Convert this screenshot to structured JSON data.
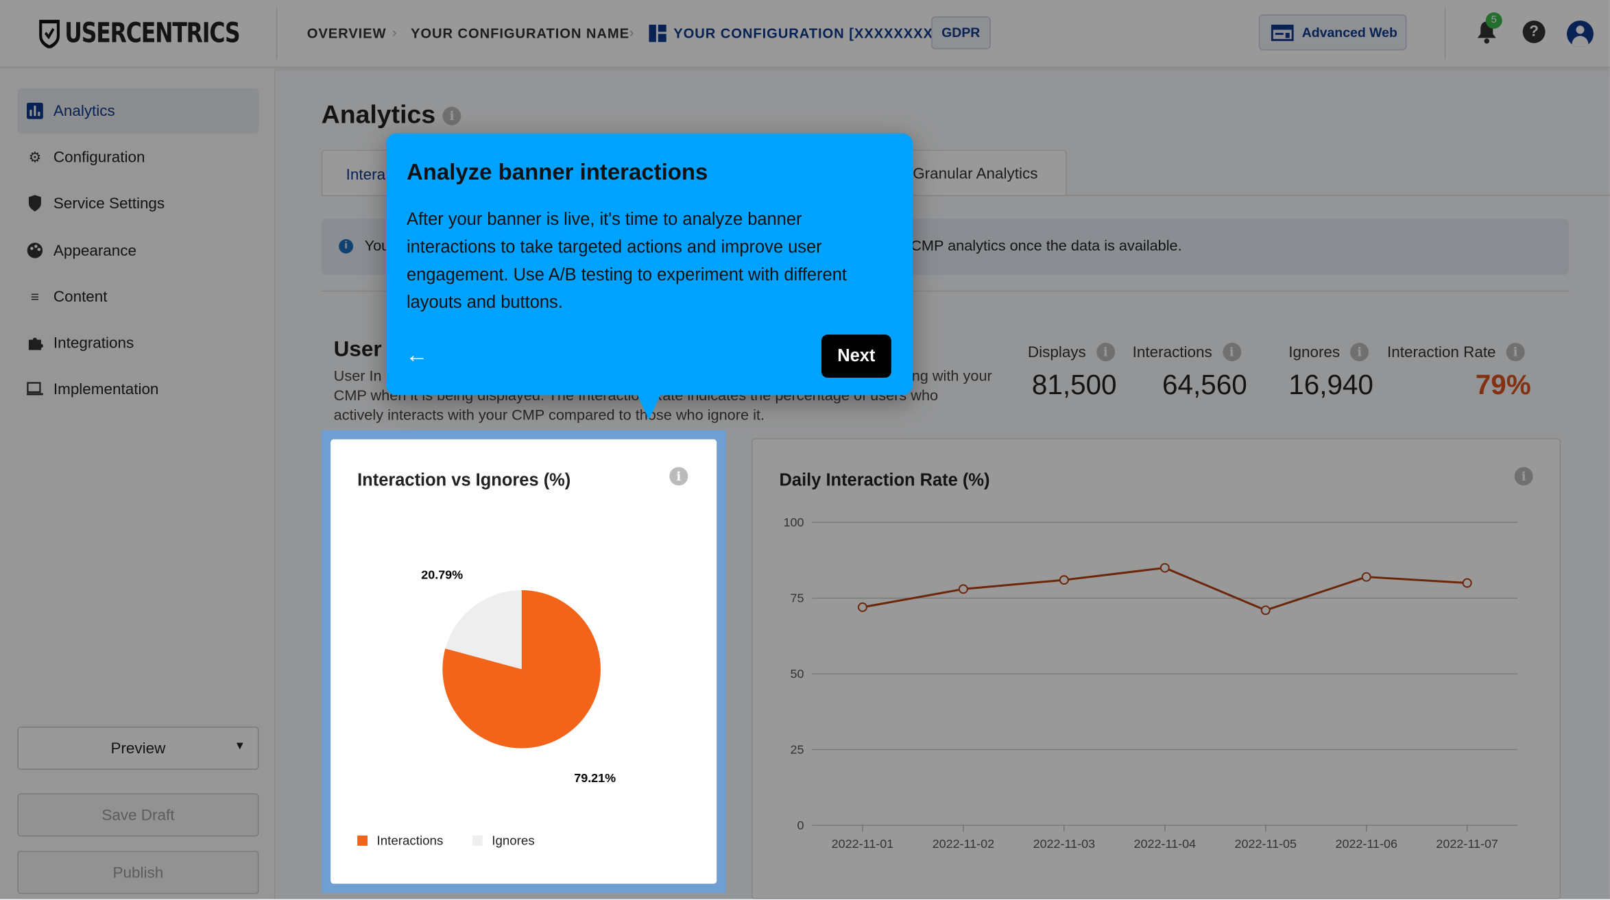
{
  "header": {
    "brand": "USERCENTRICS",
    "breadcrumb": [
      "OVERVIEW",
      "YOUR CONFIGURATION NAME",
      "YOUR CONFIGURATION [XXXXXXXX]"
    ],
    "badge": "GDPR",
    "advanced_button": "Advanced Web",
    "notification_count": "5"
  },
  "sidebar": {
    "items": [
      {
        "label": "Analytics",
        "icon": "bar-chart-icon"
      },
      {
        "label": "Configuration",
        "icon": "gear-icon"
      },
      {
        "label": "Service Settings",
        "icon": "shield-icon"
      },
      {
        "label": "Appearance",
        "icon": "palette-icon"
      },
      {
        "label": "Content",
        "icon": "lines-icon"
      },
      {
        "label": "Integrations",
        "icon": "puzzle-icon"
      },
      {
        "label": "Implementation",
        "icon": "monitor-icon"
      }
    ],
    "preview": "Preview",
    "save_draft": "Save Draft",
    "publish": "Publish"
  },
  "main": {
    "title": "Analytics",
    "tabs": [
      "Intera",
      "Granular Analytics"
    ],
    "banner_left": "You",
    "banner_right": "CMP analytics once the data is available.",
    "section_title": "User",
    "desc_line1_left": "User In",
    "desc_line1_right": "ng with your",
    "desc_line2": "CMP when it is being displayed. The Interaction Rate indicates the percentage of users who",
    "desc_line3": "actively interacts with your CMP compared to those who ignore it.",
    "stats": [
      {
        "label": "Displays",
        "value": "81,500"
      },
      {
        "label": "Interactions",
        "value": "64,560"
      },
      {
        "label": "Ignores",
        "value": "16,940"
      },
      {
        "label": "Interaction Rate",
        "value": "79%"
      }
    ]
  },
  "tooltip": {
    "title": "Analyze banner interactions",
    "body": "After your banner is live, it's time to analyze banner interactions to take targeted actions and improve user engagement. Use A/B testing to experiment with different layouts and buttons.",
    "next": "Next"
  },
  "colors": {
    "accent": "#0d3a8a",
    "orange": "#f26419",
    "line": "#b5400f",
    "tooltip": "#00a2ff"
  },
  "chart_data": [
    {
      "type": "pie",
      "title": "Interaction vs Ignores (%)",
      "slices": [
        {
          "name": "Interactions",
          "value": 79.21,
          "label": "79.21%",
          "color": "#f26419"
        },
        {
          "name": "Ignores",
          "value": 20.79,
          "label": "20.79%",
          "color": "#eeeeee"
        }
      ],
      "legend": "bottom-left"
    },
    {
      "type": "line",
      "title": "Daily Interaction Rate (%)",
      "x": [
        "2022-11-01",
        "2022-11-02",
        "2022-11-03",
        "2022-11-04",
        "2022-11-05",
        "2022-11-06",
        "2022-11-07"
      ],
      "values": [
        72,
        78,
        81,
        85,
        71,
        82,
        80
      ],
      "ylim": [
        0,
        100
      ],
      "yticks": [
        "0",
        "25",
        "50",
        "75",
        "100"
      ],
      "grid": true,
      "color": "#b5400f"
    }
  ]
}
